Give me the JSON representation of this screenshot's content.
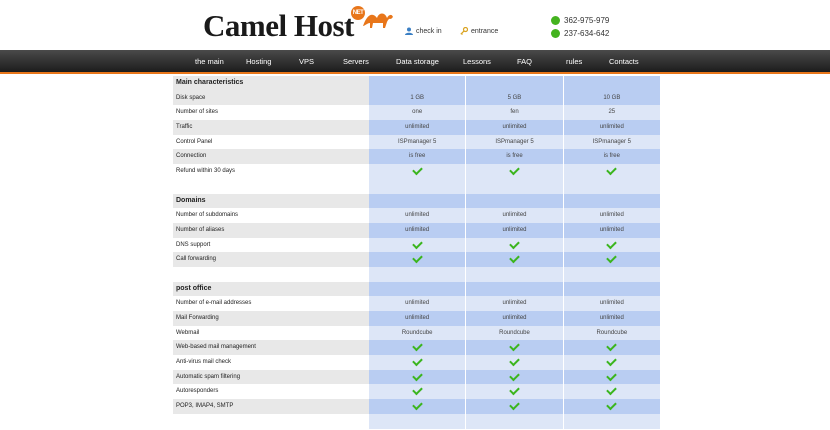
{
  "header": {
    "logo_text": "Camel Host",
    "logo_badge": "NET",
    "checkin_label": "check in",
    "entrance_label": "entrance",
    "phones": [
      "362-975-979",
      "237-634-642"
    ]
  },
  "nav": [
    "the main",
    "Hosting",
    "VPS",
    "Servers",
    "Data storage",
    "Lessons",
    "FAQ",
    "rules",
    "Contacts"
  ],
  "table": {
    "rows": [
      {
        "type": "head",
        "label": "Main characteristics"
      },
      {
        "type": "grey",
        "label": "Disk space",
        "v": [
          "1 GB",
          "5 GB",
          "10 GB"
        ]
      },
      {
        "type": "white",
        "label": "Number of sites",
        "v": [
          "one",
          "fen",
          "25"
        ]
      },
      {
        "type": "grey",
        "label": "Traffic",
        "v": [
          "unlimited",
          "unlimited",
          "unlimited"
        ]
      },
      {
        "type": "white",
        "label": "Control Panel",
        "v": [
          "ISPmanager 5",
          "ISPmanager 5",
          "ISPmanager 5"
        ]
      },
      {
        "type": "grey",
        "label": "Connection",
        "v": [
          "is free",
          "is free",
          "is free"
        ]
      },
      {
        "type": "white",
        "label": "Refund within 30 days",
        "v": [
          "check",
          "check",
          "check"
        ]
      },
      {
        "type": "blank"
      },
      {
        "type": "head",
        "label": "Domains"
      },
      {
        "type": "white",
        "label": "Number of subdomains",
        "v": [
          "unlimited",
          "unlimited",
          "unlimited"
        ]
      },
      {
        "type": "grey",
        "label": "Number of aliases",
        "v": [
          "unlimited",
          "unlimited",
          "unlimited"
        ]
      },
      {
        "type": "white",
        "label": "DNS support",
        "v": [
          "check",
          "check",
          "check"
        ]
      },
      {
        "type": "grey",
        "label": "Call forwarding",
        "v": [
          "check",
          "check",
          "check"
        ]
      },
      {
        "type": "blank"
      },
      {
        "type": "head",
        "label": "post office"
      },
      {
        "type": "white",
        "label": "Number of e-mail addresses",
        "v": [
          "unlimited",
          "unlimited",
          "unlimited"
        ]
      },
      {
        "type": "grey",
        "label": "Mail Forwarding",
        "v": [
          "unlimited",
          "unlimited",
          "unlimited"
        ]
      },
      {
        "type": "white",
        "label": "Webmail",
        "v": [
          "Roundcube",
          "Roundcube",
          "Roundcube"
        ]
      },
      {
        "type": "grey",
        "label": "Web-based mail management",
        "v": [
          "check",
          "check",
          "check"
        ]
      },
      {
        "type": "white",
        "label": "Anti-virus mail check",
        "v": [
          "check",
          "check",
          "check"
        ]
      },
      {
        "type": "grey",
        "label": "Automatic spam filtering",
        "v": [
          "check",
          "check",
          "check"
        ]
      },
      {
        "type": "white",
        "label": "Autoresponders",
        "v": [
          "check",
          "check",
          "check"
        ]
      },
      {
        "type": "grey",
        "label": "POP3, IMAP4, SMTP",
        "v": [
          "check",
          "check",
          "check"
        ]
      },
      {
        "type": "blank"
      }
    ]
  }
}
